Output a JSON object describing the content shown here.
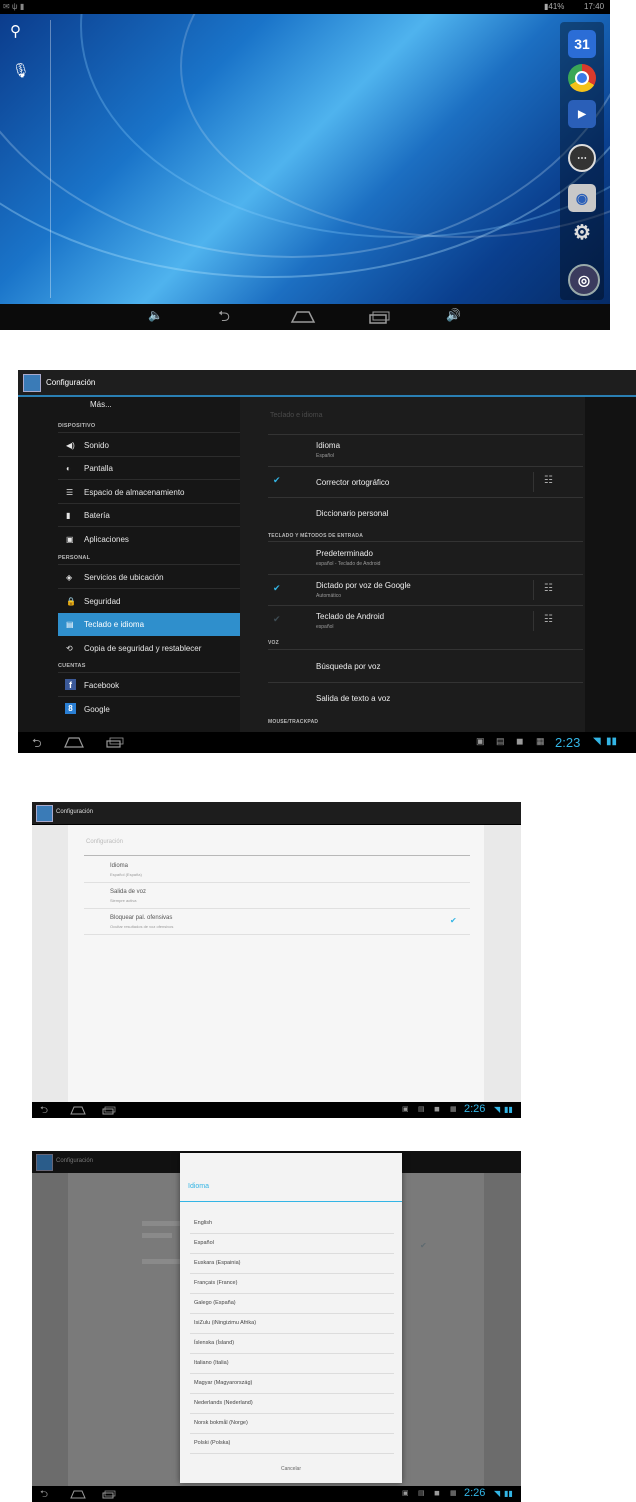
{
  "screen_home": {
    "status_time": "17:40",
    "status_battery": "41%",
    "dock_calendar_day": "31",
    "nav_icons": [
      "volume-down-icon",
      "back-icon",
      "home-icon",
      "recents-icon",
      "volume-up-icon"
    ]
  },
  "screen_settings": {
    "app_title": "Configuración",
    "left_items": [
      {
        "type": "item",
        "label": "Más..."
      },
      {
        "type": "header",
        "label": "DISPOSITIVO"
      },
      {
        "type": "item",
        "label": "Sonido",
        "icon": "speaker-icon"
      },
      {
        "type": "item",
        "label": "Pantalla",
        "icon": "brightness-icon"
      },
      {
        "type": "item",
        "label": "Espacio de almacenamiento",
        "icon": "storage-icon"
      },
      {
        "type": "item",
        "label": "Batería",
        "icon": "battery-icon"
      },
      {
        "type": "item",
        "label": "Aplicaciones",
        "icon": "apps-icon"
      },
      {
        "type": "header",
        "label": "PERSONAL"
      },
      {
        "type": "item",
        "label": "Servicios de ubicación",
        "icon": "location-icon"
      },
      {
        "type": "item",
        "label": "Seguridad",
        "icon": "lock-icon"
      },
      {
        "type": "item",
        "label": "Teclado e idioma",
        "icon": "keyboard-icon",
        "selected": true
      },
      {
        "type": "item",
        "label": "Copia de seguridad y restablecer",
        "icon": "restore-icon"
      },
      {
        "type": "header",
        "label": "CUENTAS"
      },
      {
        "type": "item",
        "label": "Facebook",
        "icon": "facebook-icon"
      },
      {
        "type": "item",
        "label": "Google",
        "icon": "google-icon"
      }
    ],
    "right_title": "Teclado e idioma",
    "right_items": [
      {
        "type": "item",
        "title": "Idioma",
        "subtitle": "Español"
      },
      {
        "type": "item",
        "title": "Corrector ortográfico",
        "checked": true,
        "settings": true
      },
      {
        "type": "item",
        "title": "Diccionario personal"
      },
      {
        "type": "header",
        "title": "TECLADO Y MÉTODOS DE ENTRADA"
      },
      {
        "type": "item",
        "title": "Predeterminado",
        "subtitle": "español - Teclado de Android"
      },
      {
        "type": "item",
        "title": "Dictado por voz de Google",
        "subtitle": "Automático",
        "checked": true,
        "settings": true
      },
      {
        "type": "item",
        "title": "Teclado de Android",
        "subtitle": "español",
        "checked": true,
        "dimcheck": true,
        "settings": true
      },
      {
        "type": "header",
        "title": "VOZ"
      },
      {
        "type": "item",
        "title": "Búsqueda por voz"
      },
      {
        "type": "item",
        "title": "Salida de texto a voz"
      },
      {
        "type": "header",
        "title": "MOUSE/TRACKPAD"
      }
    ],
    "clock": "2:23"
  },
  "screen_voice": {
    "app_title": "Configuración",
    "section_title": "Configuración",
    "items": [
      {
        "title": "Idioma",
        "subtitle": "Español (España)"
      },
      {
        "title": "Salida de voz",
        "subtitle": "Siempre activa"
      },
      {
        "title": "Bloquear pal. ofensivas",
        "subtitle": "Ocultar resultados de voz ofensivos",
        "checked": true
      }
    ],
    "clock": "2:26"
  },
  "screen_language_dialog": {
    "app_title": "Configuración",
    "dialog_title": "Idioma",
    "options": [
      "English",
      "Español",
      "Euskara (Espainia)",
      "Français (France)",
      "Galego (España)",
      "IsiZulu (iNingizimu Afrika)",
      "Íslenska (Ísland)",
      "Italiano (Italia)",
      "Magyar (Magyarország)",
      "Nederlands (Nederland)",
      "Norsk bokmål (Norge)",
      "Polski (Polska)"
    ],
    "cancel_label": "Cancelar",
    "clock": "2:26"
  }
}
